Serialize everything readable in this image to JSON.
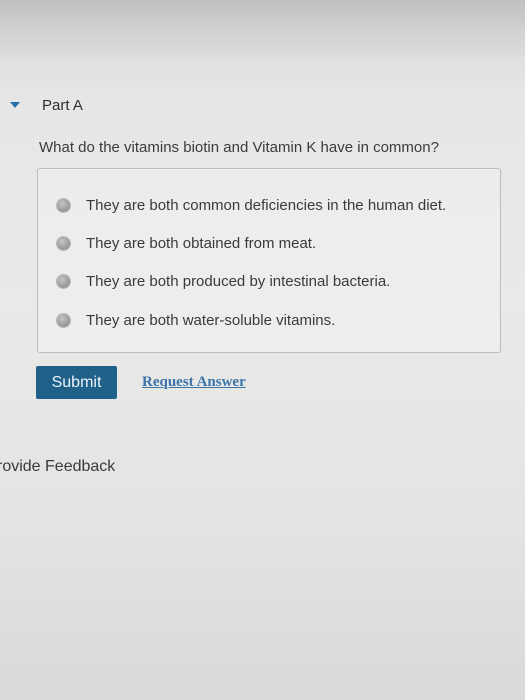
{
  "part": {
    "title": "Part A",
    "expanded_icon": "caret-down-icon"
  },
  "question": {
    "text": "What do the vitamins biotin and Vitamin K have in common?"
  },
  "options": [
    {
      "label": "They are both common deficiencies in the human diet.",
      "selected": false
    },
    {
      "label": "They are both obtained from meat.",
      "selected": false
    },
    {
      "label": "They are both produced by intestinal bacteria.",
      "selected": false
    },
    {
      "label": "They are both water-soluble vitamins.",
      "selected": false
    }
  ],
  "actions": {
    "submit_label": "Submit",
    "request_answer_label": "Request Answer"
  },
  "footer": {
    "feedback_label": "rovide Feedback"
  },
  "colors": {
    "submit_bg": "#1f6188",
    "link": "#3b74a8",
    "caret": "#2a6fa7"
  }
}
